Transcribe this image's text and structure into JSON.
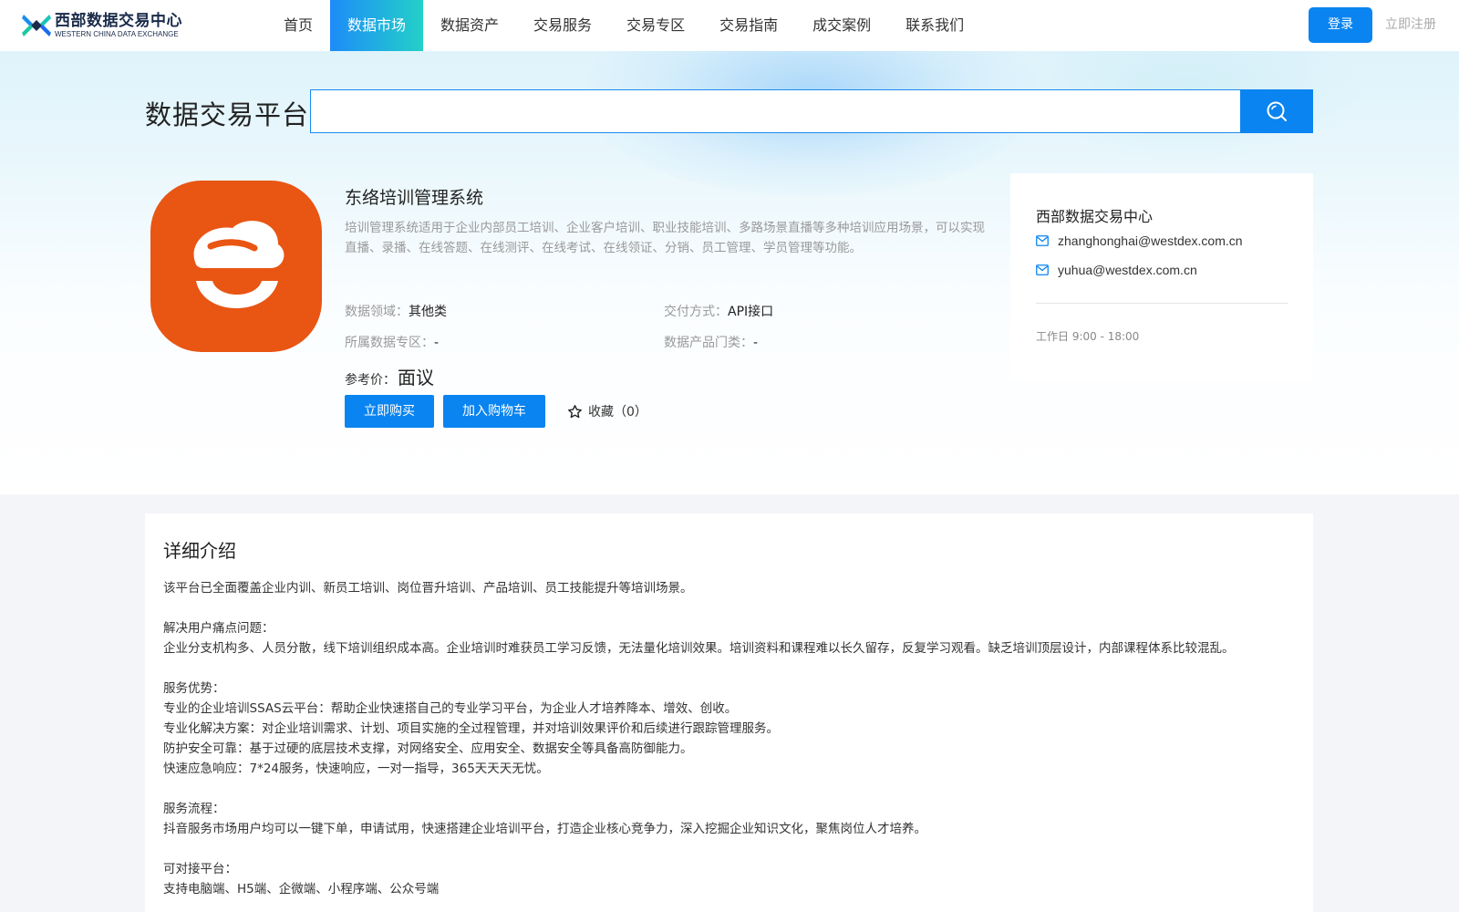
{
  "header": {
    "logo_cn": "西部数据交易中心",
    "logo_en": "WESTERN CHINA DATA EXCHANGE",
    "nav": [
      {
        "label": "首页",
        "active": false
      },
      {
        "label": "数据市场",
        "active": true
      },
      {
        "label": "数据资产",
        "active": false
      },
      {
        "label": "交易服务",
        "active": false
      },
      {
        "label": "交易专区",
        "active": false
      },
      {
        "label": "交易指南",
        "active": false
      },
      {
        "label": "成交案例",
        "active": false
      },
      {
        "label": "联系我们",
        "active": false
      }
    ],
    "login_label": "登录",
    "register_label": "立即注册"
  },
  "search": {
    "title": "数据交易平台",
    "value": "",
    "placeholder": ""
  },
  "product": {
    "name": "东络培训管理系统",
    "description": "培训管理系统适用于企业内部员工培训、企业客户培训、职业技能培训、多路场景直播等多种培训应用场景，可以实现直播、录播、在线答题、在线测评、在线考试、在线领证、分销、员工管理、学员管理等功能。",
    "domain_label": "数据领域：",
    "domain_value": "其他类",
    "delivery_label": "交付方式：",
    "delivery_value": "API接口",
    "zone_label": "所属数据专区：",
    "zone_value": "-",
    "category_label": "数据产品门类：",
    "category_value": "-",
    "price_label": "参考价：",
    "price_value": "面议",
    "buy_label": "立即购买",
    "cart_label": "加入购物车",
    "favorite_label": "收藏（0）"
  },
  "contact": {
    "title": "西部数据交易中心",
    "emails": [
      "zhanghonghai@westdex.com.cn",
      "yuhua@westdex.com.cn"
    ],
    "hours": "工作日 9:00 - 18:00"
  },
  "details": {
    "title": "详细介绍",
    "lines": [
      "该平台已全面覆盖企业内训、新员工培训、岗位晋升培训、产品培训、员工技能提升等培训场景。",
      "",
      "解决用户痛点问题：",
      "企业分支机构多、人员分散，线下培训组织成本高。企业培训时难获员工学习反馈，无法量化培训效果。培训资料和课程难以长久留存，反复学习观看。缺乏培训顶层设计，内部课程体系比较混乱。",
      "",
      "服务优势：",
      "专业的企业培训SSAS云平台：帮助企业快速搭自己的专业学习平台，为企业人才培养降本、增效、创收。",
      "专业化解决方案：对企业培训需求、计划、项目实施的全过程管理，并对培训效果评价和后续进行跟踪管理服务。",
      "防护安全可靠：基于过硬的底层技术支撑，对网络安全、应用安全、数据安全等具备高防御能力。",
      "快速应急响应：7*24服务，快速响应，一对一指导，365天天天无忧。",
      "",
      "服务流程：",
      "抖音服务市场用户均可以一键下单，申请试用，快速搭建企业培训平台，打造企业核心竞争力，深入挖掘企业知识文化，聚焦岗位人才培养。",
      "",
      "可对接平台：",
      "支持电脑端、H5端、企微端、小程序端、公众号端"
    ]
  },
  "icons": {
    "logo": "data-exchange-logo-icon",
    "search": "search-icon",
    "product": "smiling-hat-app-icon",
    "favorite": "star-icon",
    "mail": "mail-icon"
  },
  "colors": {
    "primary": "#0a84f0",
    "nav_active_start": "#1d8cf8",
    "nav_active_end": "#23d0c8",
    "product_icon": "#e95513"
  }
}
